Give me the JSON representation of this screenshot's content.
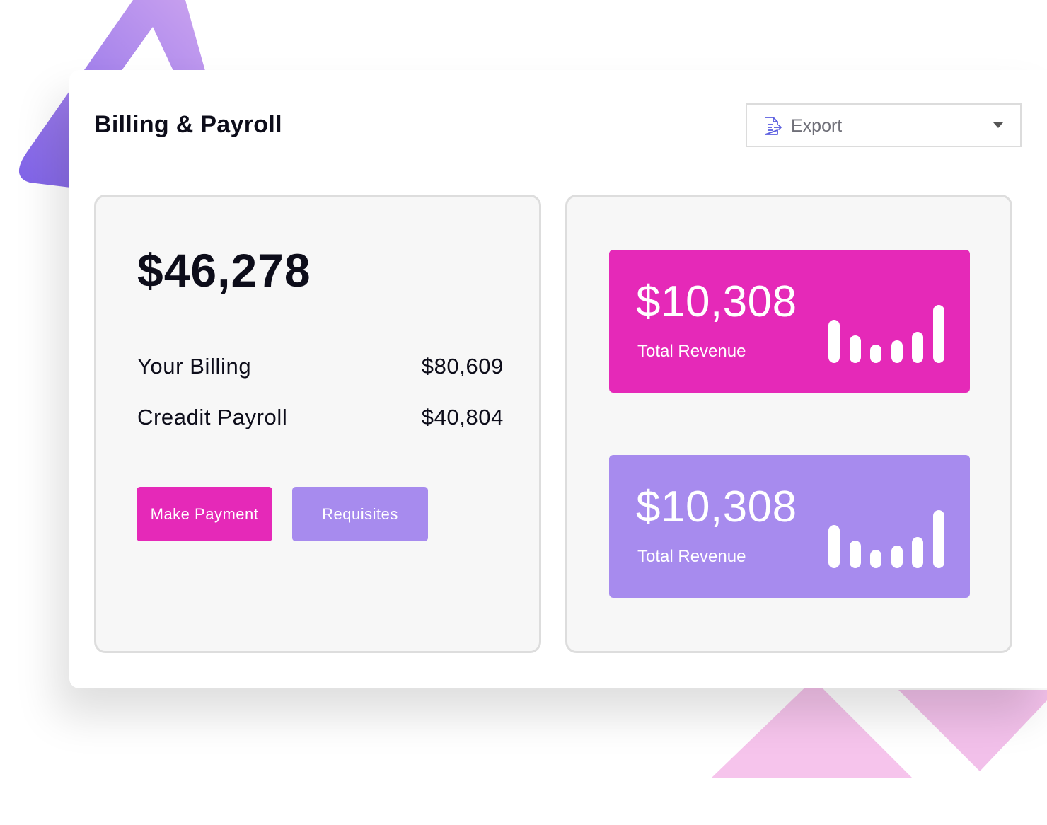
{
  "header": {
    "title": "Billing & Payroll",
    "export_label": "Export",
    "export_icon": "export-document-icon",
    "caret_icon": "chevron-down-icon"
  },
  "summary": {
    "total": "$46,278",
    "rows": [
      {
        "label": "Your Billing",
        "value": "$80,609"
      },
      {
        "label": "Creadit Payroll",
        "value": "$40,804"
      }
    ],
    "buttons": {
      "primary": "Make Payment",
      "secondary": "Requisites"
    }
  },
  "stats": [
    {
      "value": "$10,308",
      "label": "Total Revenue",
      "color": "#e529b8",
      "bar_levels": [
        0.61,
        0.39,
        0.26,
        0.32,
        0.44,
        0.82
      ]
    },
    {
      "value": "$10,308",
      "label": "Total Revenue",
      "color": "#a78bee",
      "bar_levels": [
        0.61,
        0.39,
        0.26,
        0.32,
        0.44,
        0.82
      ]
    }
  ],
  "colors": {
    "accent_pink": "#e529b8",
    "accent_purple": "#a78bee",
    "text_dark": "#0d0d1a"
  }
}
